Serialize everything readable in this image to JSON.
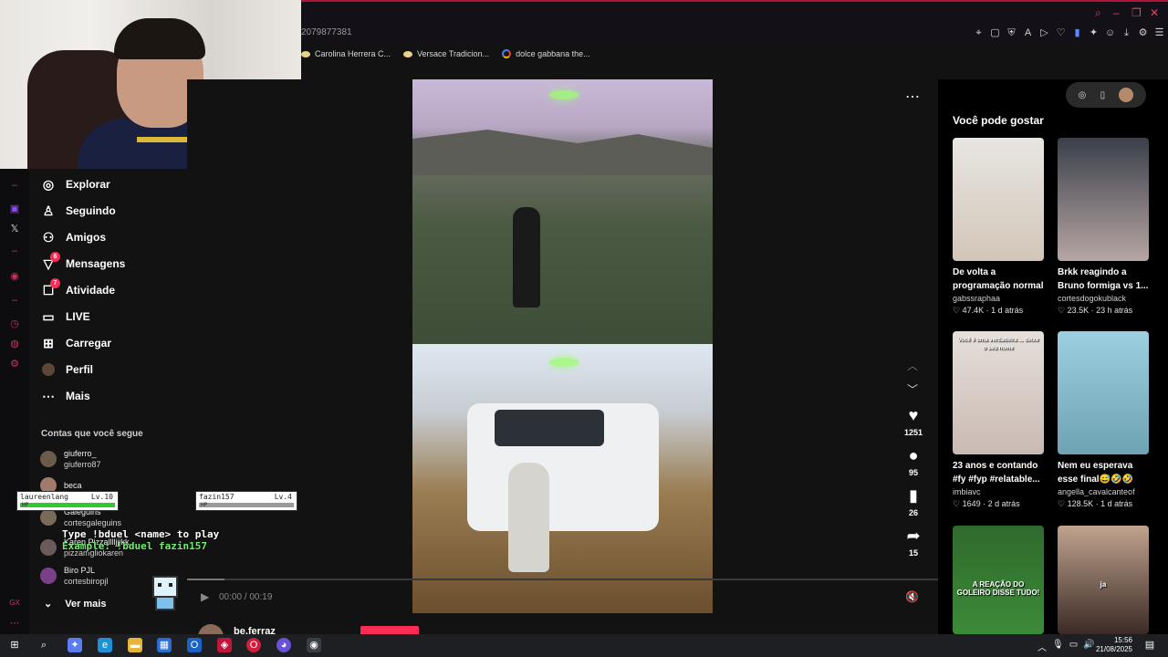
{
  "browser": {
    "url_fragment": "2079877381",
    "bookmarks": [
      {
        "label": "Carolina Herrera C...",
        "icon": "perfume-icon"
      },
      {
        "label": "Versace Tradicion...",
        "icon": "perfume-icon"
      },
      {
        "label": "dolce gabbana the...",
        "icon": "google-icon"
      }
    ]
  },
  "sidebar": {
    "nav": [
      {
        "label": "Explorar",
        "icon": "compass-icon"
      },
      {
        "label": "Seguindo",
        "icon": "user-follow-icon"
      },
      {
        "label": "Amigos",
        "icon": "friends-icon"
      },
      {
        "label": "Mensagens",
        "icon": "message-icon",
        "badge": "6"
      },
      {
        "label": "Atividade",
        "icon": "activity-icon",
        "badge": "7"
      },
      {
        "label": "LIVE",
        "icon": "live-icon"
      },
      {
        "label": "Carregar",
        "icon": "upload-icon"
      },
      {
        "label": "Perfil",
        "icon": "profile-icon"
      },
      {
        "label": "Mais",
        "icon": "more-icon"
      }
    ],
    "following_title": "Contas que você segue",
    "accounts": [
      {
        "name": "giuferro_",
        "user": "giuferro87"
      },
      {
        "name": "beca",
        "user": ""
      },
      {
        "name": "Galeguins",
        "user": "cortesgaleguins"
      },
      {
        "name": "Karen Pizzalllljjjkk",
        "user": "pizzamgliokaren"
      },
      {
        "name": "Biro PJL",
        "user": "cortesbiropjl"
      }
    ],
    "see_more": "Ver mais"
  },
  "game_overlay": {
    "players": [
      {
        "name": "laureenlang",
        "level": "Lv.10",
        "hp_label": "HP",
        "hp": 1.0
      },
      {
        "name": "fazin157",
        "level": "Lv.4",
        "hp_label": "HP",
        "hp": 0.0
      }
    ],
    "help": "Type !bduel <name> to play",
    "example": "Example: !bduel fazin157"
  },
  "video": {
    "likes": "1251",
    "comments": "95",
    "saves": "26",
    "shares": "15",
    "time": "00:00 / 00:19",
    "progress": 0.05,
    "author": "be.ferraz"
  },
  "recommendations": {
    "title": "Você pode gostar",
    "cards": [
      {
        "title": "De volta a programação normal",
        "user": "gabssraphaa",
        "likes": "47.4K",
        "time": "1 d atrás",
        "colors": [
          "#e8e6e2",
          "#d3c6b8"
        ]
      },
      {
        "title": "Brkk reagindo a Bruno formiga vs 1...",
        "user": "cortesdogokublack",
        "likes": "23.5K",
        "time": "23 h atrás",
        "colors": [
          "#3a3f4a",
          "#b7a6a4"
        ]
      },
      {
        "title": "23 anos e contando #fy #fyp #relatable...",
        "user": "imbiavc",
        "likes": "1649",
        "time": "2 d atrás",
        "colors": [
          "#e6dfda",
          "#c9b9b2"
        ],
        "caption": "Você é uma verdadeira ... deixe o seu nome"
      },
      {
        "title": "Nem eu esperava esse final😅🤣🤣",
        "user": "angella_cavalcanteof",
        "likes": "128.5K",
        "time": "1 d atrás",
        "colors": [
          "#9ccfe0",
          "#6ea3b3"
        ]
      },
      {
        "title": "",
        "user": "",
        "likes": "",
        "time": "",
        "colors": [
          "#2f6a2d",
          "#3c8b38"
        ],
        "caption": "A REAÇÃO DO GOLEIRO DISSE TUDO!"
      },
      {
        "title": "",
        "user": "",
        "likes": "",
        "time": "",
        "colors": [
          "#c0a48e",
          "#3b2a26"
        ],
        "caption": "ja"
      }
    ]
  },
  "taskbar": {
    "time": "15:56",
    "date": "21/08/2025"
  },
  "colors": {
    "accent": "#fe2c55",
    "hp_green": "#32c832",
    "overlay_green": "#6cf06c"
  }
}
